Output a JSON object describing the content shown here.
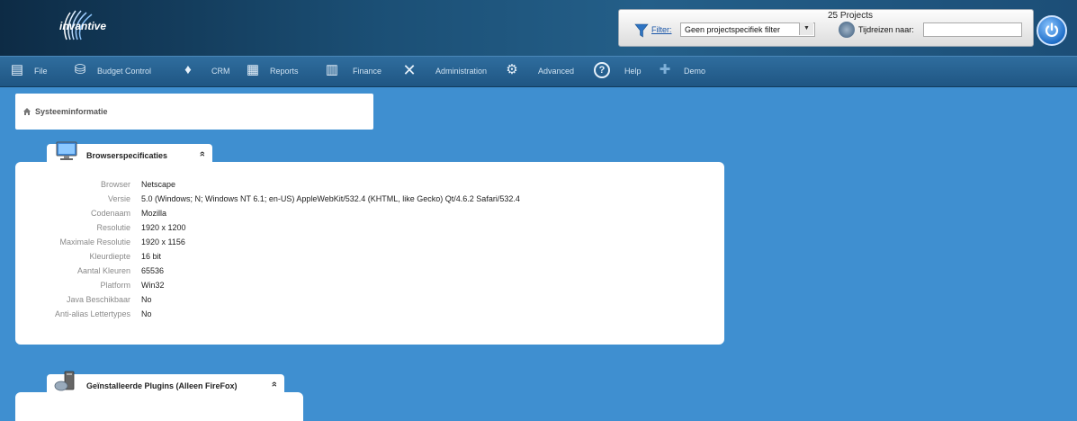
{
  "header": {
    "logo_text": "invantive",
    "projects_count": "25 Projects",
    "filter_label": "Filter:",
    "filter_value": "Geen projectspecifiek filter",
    "tijdreizen_label": "Tijdreizen naar:",
    "tijdreizen_value": ""
  },
  "nav": {
    "items": [
      {
        "label": "File",
        "icon": "file-icon"
      },
      {
        "label": "Budget Control",
        "icon": "budget-control-icon"
      },
      {
        "label": "CRM",
        "icon": "crm-icon"
      },
      {
        "label": "Reports",
        "icon": "reports-icon"
      },
      {
        "label": "Finance",
        "icon": "finance-icon"
      },
      {
        "label": "Administration",
        "icon": "administration-icon"
      },
      {
        "label": "Advanced",
        "icon": "advanced-icon"
      },
      {
        "label": "Help",
        "icon": "help-icon"
      },
      {
        "label": "Demo",
        "icon": "demo-icon"
      }
    ]
  },
  "breadcrumb": {
    "text": "Systeeminformatie"
  },
  "browser_panel": {
    "title": "Browserspecificaties",
    "toggle": "»",
    "rows": [
      {
        "label": "Browser",
        "value": "Netscape"
      },
      {
        "label": "Versie",
        "value": "5.0 (Windows; N; Windows NT 6.1; en-US) AppleWebKit/532.4 (KHTML, like Gecko) Qt/4.6.2 Safari/532.4"
      },
      {
        "label": "Codenaam",
        "value": "Mozilla"
      },
      {
        "label": "Resolutie",
        "value": "1920 x 1200"
      },
      {
        "label": "Maximale Resolutie",
        "value": "1920 x 1156"
      },
      {
        "label": "Kleurdiepte",
        "value": "16 bit"
      },
      {
        "label": "Aantal Kleuren",
        "value": "65536"
      },
      {
        "label": "Platform",
        "value": "Win32"
      },
      {
        "label": "Java Beschikbaar",
        "value": "No"
      },
      {
        "label": "Anti-alias Lettertypes",
        "value": "No"
      }
    ]
  },
  "plugins_panel": {
    "title": "Geïnstalleerde Plugins (Alleen FireFox)",
    "toggle": "»"
  },
  "colors": {
    "background": "#3f8fd0",
    "header": "#1b4f75",
    "nav": "#2a6594"
  }
}
